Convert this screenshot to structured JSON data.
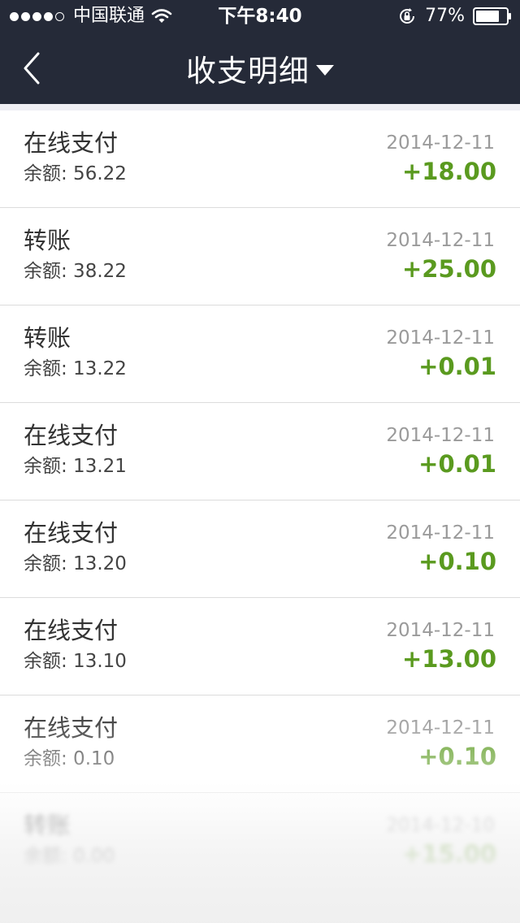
{
  "status_bar": {
    "carrier": "中国联通",
    "time": "下午8:40",
    "battery": "77%",
    "icons": [
      "signal-dots",
      "wifi-icon",
      "rotation-lock-icon",
      "battery-icon"
    ]
  },
  "navbar": {
    "title": "收支明细",
    "back_icon": "chevron-left-icon",
    "dropdown_icon": "caret-down-icon"
  },
  "colors": {
    "nav_background": "#252a38",
    "amount_positive": "#5a9a1f",
    "date_gray": "#9a9a9a"
  },
  "transactions": [
    {
      "type": "在线支付",
      "balance": "余额: 56.22",
      "date": "2014-12-11",
      "amount": "+18.00"
    },
    {
      "type": "转账",
      "balance": "余额: 38.22",
      "date": "2014-12-11",
      "amount": "+25.00"
    },
    {
      "type": "转账",
      "balance": "余额: 13.22",
      "date": "2014-12-11",
      "amount": "+0.01"
    },
    {
      "type": "在线支付",
      "balance": "余额: 13.21",
      "date": "2014-12-11",
      "amount": "+0.01"
    },
    {
      "type": "在线支付",
      "balance": "余额: 13.20",
      "date": "2014-12-11",
      "amount": "+0.10"
    },
    {
      "type": "在线支付",
      "balance": "余额: 13.10",
      "date": "2014-12-11",
      "amount": "+13.00"
    },
    {
      "type": "在线支付",
      "balance": "余额: 0.10",
      "date": "2014-12-11",
      "amount": "+0.10"
    },
    {
      "type": "转账",
      "balance": "余额: 0.00",
      "date": "2014-12-10",
      "amount": "+15.00"
    }
  ]
}
